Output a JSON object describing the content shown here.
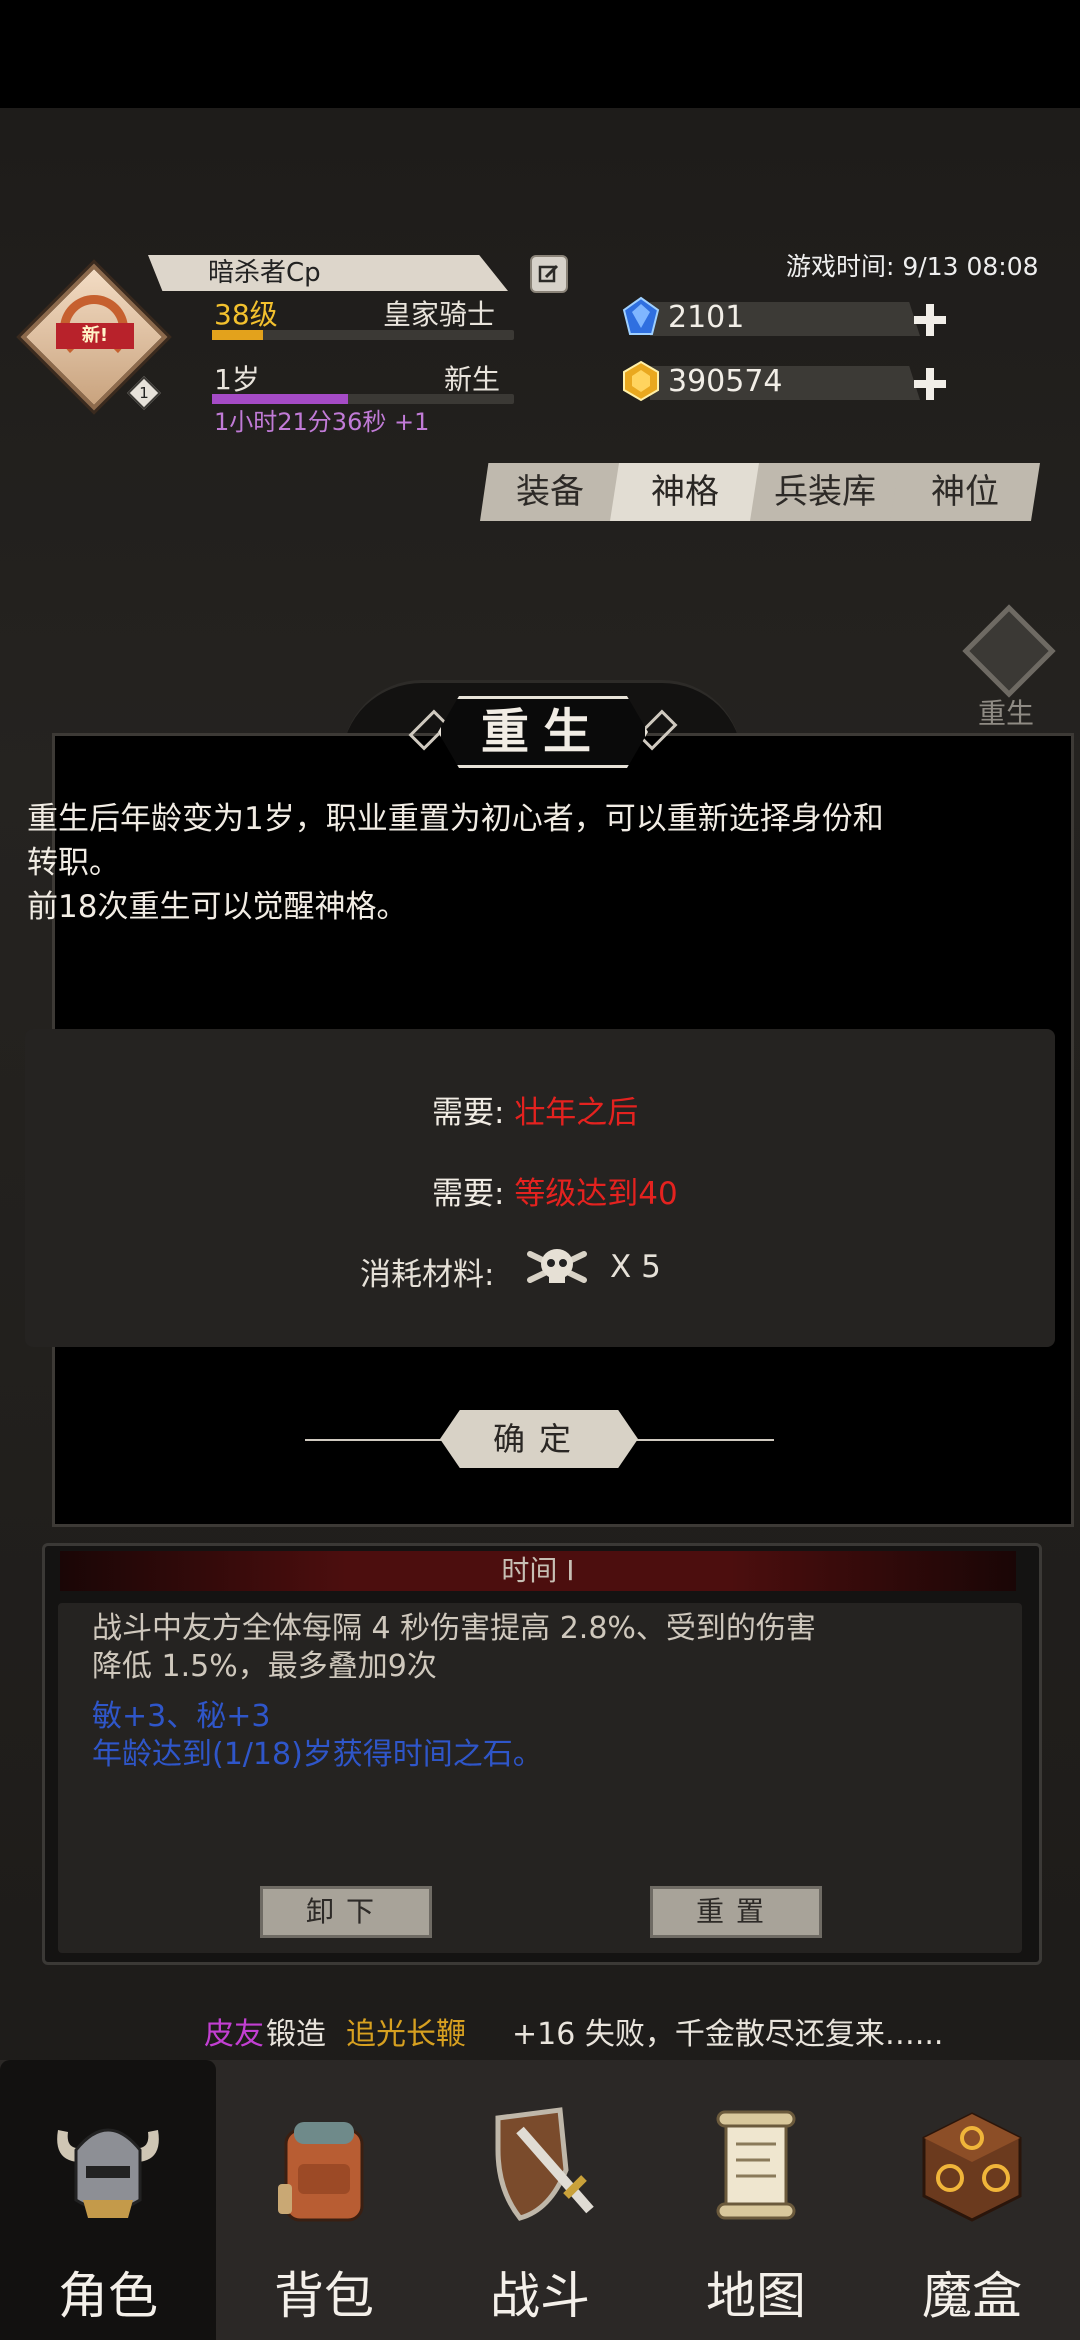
{
  "player": {
    "name": "暗杀者Cp",
    "badge_new": "新!",
    "rank_badge": "1",
    "level": "38级",
    "job": "皇家骑士",
    "age": "1岁",
    "stage": "新生",
    "timer": "1小时21分36秒 +1"
  },
  "game_time": "游戏时间: 9/13 08:08",
  "currencies": [
    {
      "icon": "blue-gem-icon",
      "value": "2101"
    },
    {
      "icon": "gold-gem-icon",
      "value": "390574"
    }
  ],
  "tabs": [
    "装备",
    "神格",
    "兵装库",
    "神位"
  ],
  "active_tab": "神格",
  "side_button": "重生",
  "dialog": {
    "title": "重生",
    "desc_line1": "重生后年龄变为1岁，职业重置为初心者，可以重新选择身份和",
    "desc_line2": "转职。",
    "desc_line3": "前18次重生可以觉醒神格。",
    "req1_label": "需要:",
    "req1_value": "壮年之后",
    "req2_label": "需要:",
    "req2_value": "等级达到40",
    "cost_label": "消耗材料:",
    "cost_icon": "skull-icon",
    "cost_qty": "X 5",
    "confirm": "确定"
  },
  "info": {
    "title": "时间 I",
    "line1": "战斗中友方全体每隔 4 秒伤害提高 2.8%、受到的伤害",
    "line2": "降低 1.5%，最多叠加9次",
    "stat": "敏+3、秘+3",
    "note": "年龄达到(1/18)岁获得时间之石。",
    "btn_unequip": "卸下",
    "btn_reset": "重置"
  },
  "ticker": {
    "player": "皮友",
    "action": "锻造",
    "item": "追光长鞭",
    "rest": " +16 失败，千金散尽还复来…..."
  },
  "nav": [
    {
      "label": "角色",
      "icon": "helmet-icon"
    },
    {
      "label": "背包",
      "icon": "backpack-icon"
    },
    {
      "label": "战斗",
      "icon": "sword-shield-icon"
    },
    {
      "label": "地图",
      "icon": "scroll-map-icon"
    },
    {
      "label": "魔盒",
      "icon": "magic-box-icon"
    }
  ],
  "colors": {
    "level": "#f3c12e",
    "timer": "#c17bd7",
    "requirement": "#e4221f",
    "stat_blue": "#2f56c9",
    "ticker_player": "#c23fd2",
    "ticker_item": "#d7a020"
  },
  "progress": {
    "level_exp": 0.17,
    "age": 0.45
  }
}
